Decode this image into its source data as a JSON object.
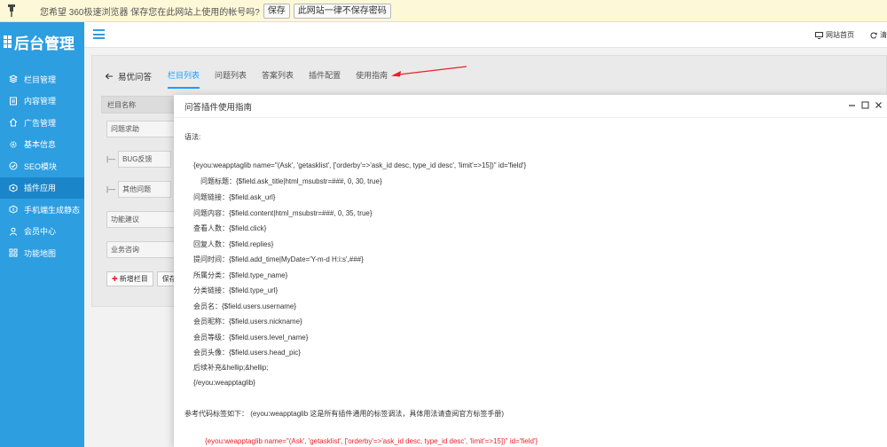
{
  "browser_bar": {
    "message": "您希望 360极速浏览器 保存您在此网站上使用的帐号吗?",
    "save_label": "保存",
    "never_label": "此网站一律不保存密码"
  },
  "sidebar": {
    "logo_text": "后台管理",
    "items": [
      {
        "label": "栏目管理",
        "icon": "layers-icon"
      },
      {
        "label": "内容管理",
        "icon": "document-icon"
      },
      {
        "label": "广告管理",
        "icon": "home-icon"
      },
      {
        "label": "基本信息",
        "icon": "gear-icon"
      },
      {
        "label": "SEO模块",
        "icon": "seo-icon"
      },
      {
        "label": "插件应用",
        "icon": "plugin-icon"
      },
      {
        "label": "手机端生成静态",
        "icon": "mobile-icon"
      },
      {
        "label": "会员中心",
        "icon": "user-icon"
      },
      {
        "label": "功能地图",
        "icon": "grid-icon"
      }
    ]
  },
  "topbar": {
    "home_link": "网站首页",
    "refresh_link": "清"
  },
  "panel": {
    "back_label": "易优问答",
    "tabs": [
      "栏目列表",
      "问题列表",
      "答案列表",
      "插件配置",
      "使用指南"
    ],
    "table_header": "栏目名称",
    "rows": [
      {
        "prefix": "",
        "name": "问题求助"
      },
      {
        "prefix": "|—",
        "name": "BUG反馈"
      },
      {
        "prefix": "|—",
        "name": "其他问题"
      },
      {
        "prefix": "",
        "name": "功能建议"
      },
      {
        "prefix": "",
        "name": "业务咨询"
      }
    ],
    "add_label": "新增栏目",
    "save_label": "保存"
  },
  "modal": {
    "title": "问答插件使用指南",
    "syntax_label": "语法:",
    "lines": [
      "{eyou:weapptaglib name=\"(Ask', 'getasklist', ['orderby'=>'ask_id desc, type_id desc', 'limit'=>15])\" id='field'}",
      "问题标题：{$field.ask_title|html_msubstr=###, 0, 30, true}",
      "问题链接：{$field.ask_url}",
      "问题内容：{$field.content|html_msubstr=###, 0, 35, true}",
      "查看人数：{$field.click}",
      "回复人数：{$field.replies}",
      "提问时间：{$field.add_time|MyDate='Y-m-d H:i:s',###}",
      "所属分类：{$field.type_name}",
      "分类链接：{$field.type_url}",
      "会员名：{$field.users.username}",
      "会员昵称：{$field.users.nickname}",
      "会员等级：{$field.users.level_name}",
      "会员头像：{$field.users.head_pic}",
      "后续补充&hellip;&hellip;",
      "{/eyou:weapptaglib}"
    ],
    "reference_text": "参考代码标签如下：  (eyou:weapptaglib 这是所有插件通用的标签调法，具体用法请查阅官方标签手册)",
    "red_line": "{eyou:weapptaglib name=\"(Ask', 'getasklist', ['orderby'=>'ask_id desc, type_id desc', 'limit'=>15])\" id='field'}"
  },
  "colors": {
    "sidebar_bg": "#2d9ee0",
    "sidebar_active": "#1a86c9",
    "accent": "#1e9fff",
    "annotation_arrow": "#e8212a",
    "code_red": "#e8212a"
  }
}
